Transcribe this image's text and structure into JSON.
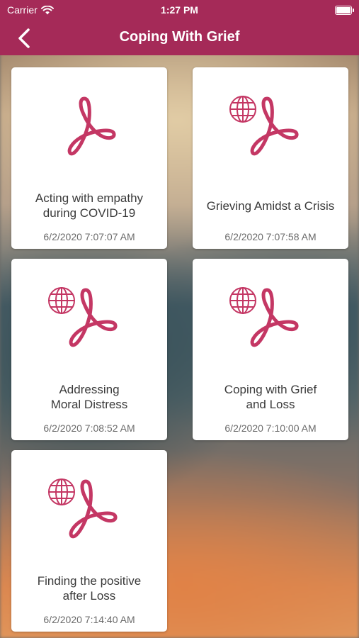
{
  "status_bar": {
    "carrier": "Carrier",
    "time": "1:27 PM"
  },
  "nav": {
    "title": "Coping With Grief",
    "back_icon": "chevron-left-icon"
  },
  "colors": {
    "brand": "#a52a58",
    "pdf_icon": "#c43764"
  },
  "documents": [
    {
      "title": "Acting with empathy\nduring COVID-19",
      "date": "6/2/2020 7:07:07 AM",
      "has_web_icon": false
    },
    {
      "title": "Grieving Amidst a Crisis",
      "date": "6/2/2020 7:07:58 AM",
      "has_web_icon": true
    },
    {
      "title": "Addressing\nMoral Distress",
      "date": "6/2/2020 7:08:52 AM",
      "has_web_icon": true
    },
    {
      "title": "Coping with Grief\nand Loss",
      "date": "6/2/2020 7:10:00 AM",
      "has_web_icon": true
    },
    {
      "title": "Finding the positive\nafter Loss",
      "date": "6/2/2020 7:14:40 AM",
      "has_web_icon": true
    }
  ]
}
